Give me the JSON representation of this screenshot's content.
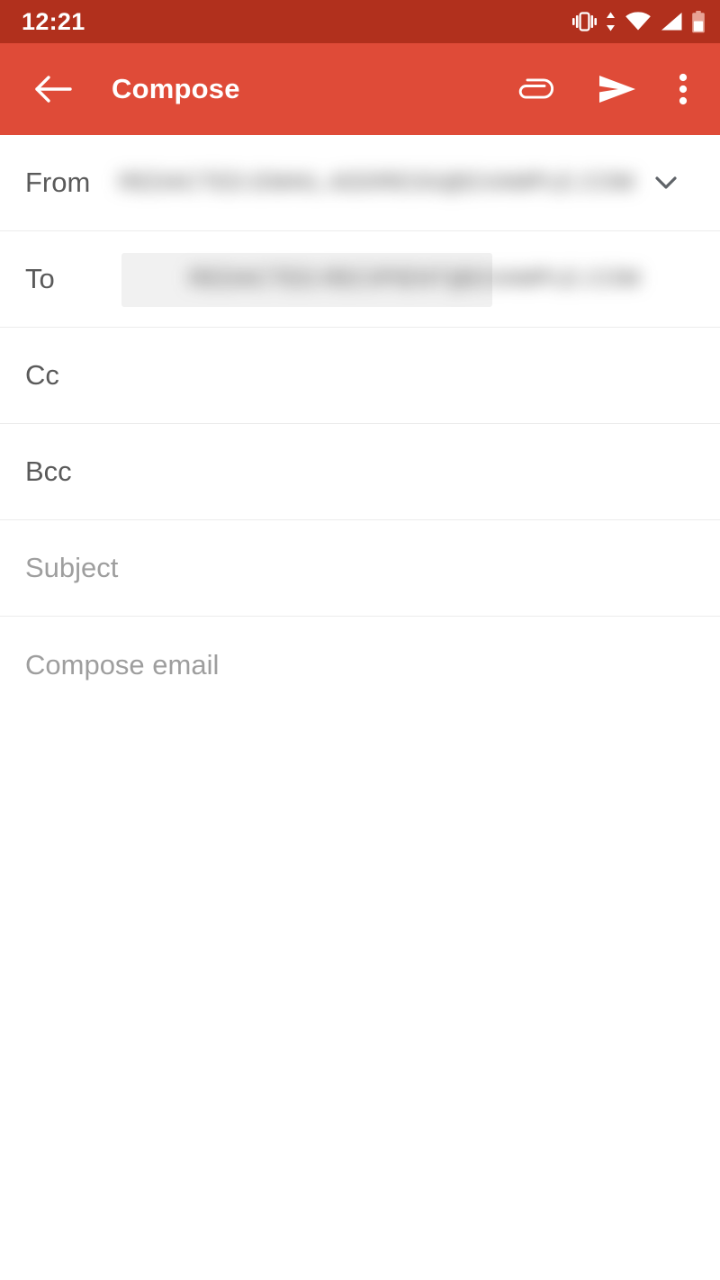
{
  "status_bar": {
    "time": "12:21",
    "icons": [
      {
        "name": "vibrate-icon",
        "label": "vibrate"
      },
      {
        "name": "data-transfer-icon",
        "label": "data transfer up down"
      },
      {
        "name": "wifi-icon",
        "label": "wifi full"
      },
      {
        "name": "cellular-signal-icon",
        "label": "cellular signal full"
      },
      {
        "name": "battery-icon",
        "label": "battery low"
      }
    ],
    "background_color": "#b1301d",
    "foreground_color": "#ffffff"
  },
  "app_bar": {
    "title": "Compose",
    "back_icon": "arrow-back-icon",
    "background_color": "#df4b38",
    "foreground_color": "#ffffff",
    "actions": [
      {
        "name": "attach-button",
        "icon": "paperclip-icon",
        "label": "Attach"
      },
      {
        "name": "send-button",
        "icon": "send-icon",
        "label": "Send"
      },
      {
        "name": "overflow-menu-button",
        "icon": "more-vert-icon",
        "label": "More options"
      }
    ]
  },
  "compose_form": {
    "rows": [
      {
        "name": "from",
        "label": "From",
        "value": "REDACTED.EMAIL.ADDRESS@EXAMPLE.COM",
        "value_redacted": true,
        "has_chevron": true,
        "chevron_icon": "chevron-down-icon",
        "has_chip": false
      },
      {
        "name": "to",
        "label": "To",
        "value": "REDACTED.RECIPIENT@EXAMPLE.COM",
        "value_redacted": true,
        "has_chevron": false,
        "has_chip": true
      },
      {
        "name": "cc",
        "label": "Cc",
        "value": "",
        "value_redacted": false,
        "has_chevron": false,
        "has_chip": false
      },
      {
        "name": "bcc",
        "label": "Bcc",
        "value": "",
        "value_redacted": false,
        "has_chevron": false,
        "has_chip": false
      },
      {
        "name": "subject",
        "label": "Subject",
        "is_placeholder": true,
        "value": "",
        "value_redacted": false,
        "has_chevron": false,
        "has_chip": false
      }
    ],
    "body": {
      "name": "compose-body",
      "placeholder": "Compose email",
      "value": ""
    },
    "divider_color": "#ececec",
    "label_color": "#5a5a5a",
    "placeholder_color": "#9e9e9e",
    "chip_background": "#f1f1f1"
  }
}
